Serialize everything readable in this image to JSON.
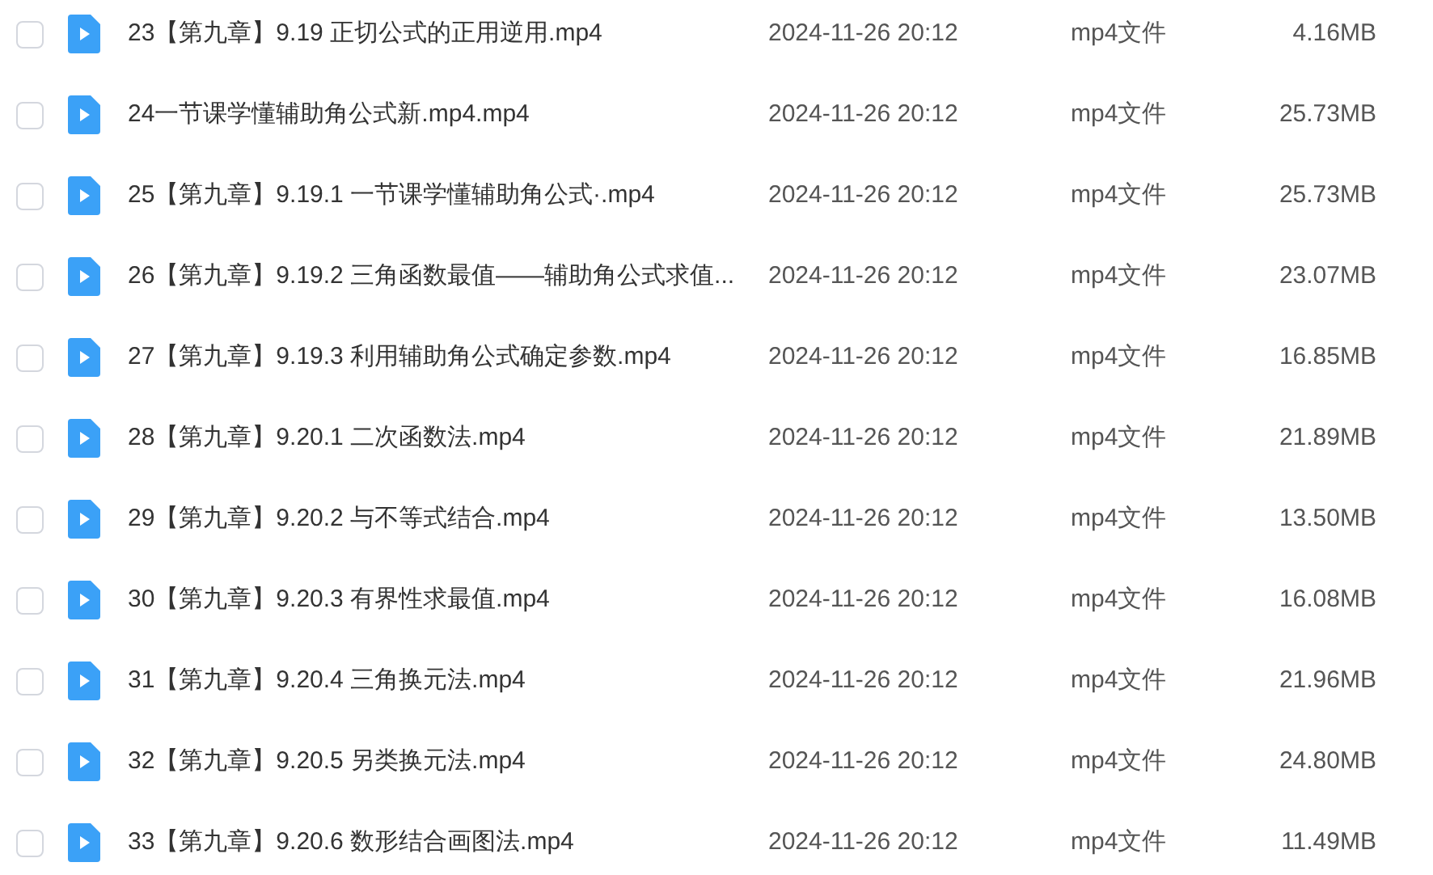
{
  "files": [
    {
      "name": "23【第九章】9.19 正切公式的正用逆用.mp4",
      "date": "2024-11-26 20:12",
      "type": "mp4文件",
      "size": "4.16MB",
      "checked": false
    },
    {
      "name": "24一节课学懂辅助角公式新.mp4.mp4",
      "date": "2024-11-26 20:12",
      "type": "mp4文件",
      "size": "25.73MB",
      "checked": false
    },
    {
      "name": "25【第九章】9.19.1 一节课学懂辅助角公式·.mp4",
      "date": "2024-11-26 20:12",
      "type": "mp4文件",
      "size": "25.73MB",
      "checked": false
    },
    {
      "name": "26【第九章】9.19.2 三角函数最值——辅助角公式求值...",
      "date": "2024-11-26 20:12",
      "type": "mp4文件",
      "size": "23.07MB",
      "checked": false
    },
    {
      "name": "27【第九章】9.19.3 利用辅助角公式确定参数.mp4",
      "date": "2024-11-26 20:12",
      "type": "mp4文件",
      "size": "16.85MB",
      "checked": false
    },
    {
      "name": "28【第九章】9.20.1 二次函数法.mp4",
      "date": "2024-11-26 20:12",
      "type": "mp4文件",
      "size": "21.89MB",
      "checked": false
    },
    {
      "name": "29【第九章】9.20.2 与不等式结合.mp4",
      "date": "2024-11-26 20:12",
      "type": "mp4文件",
      "size": "13.50MB",
      "checked": false
    },
    {
      "name": "30【第九章】9.20.3 有界性求最值.mp4",
      "date": "2024-11-26 20:12",
      "type": "mp4文件",
      "size": "16.08MB",
      "checked": false
    },
    {
      "name": "31【第九章】9.20.4 三角换元法.mp4",
      "date": "2024-11-26 20:12",
      "type": "mp4文件",
      "size": "21.96MB",
      "checked": false
    },
    {
      "name": "32【第九章】9.20.5 另类换元法.mp4",
      "date": "2024-11-26 20:12",
      "type": "mp4文件",
      "size": "24.80MB",
      "checked": false
    },
    {
      "name": "33【第九章】9.20.6 数形结合画图法.mp4",
      "date": "2024-11-26 20:12",
      "type": "mp4文件",
      "size": "11.49MB",
      "checked": false
    }
  ]
}
